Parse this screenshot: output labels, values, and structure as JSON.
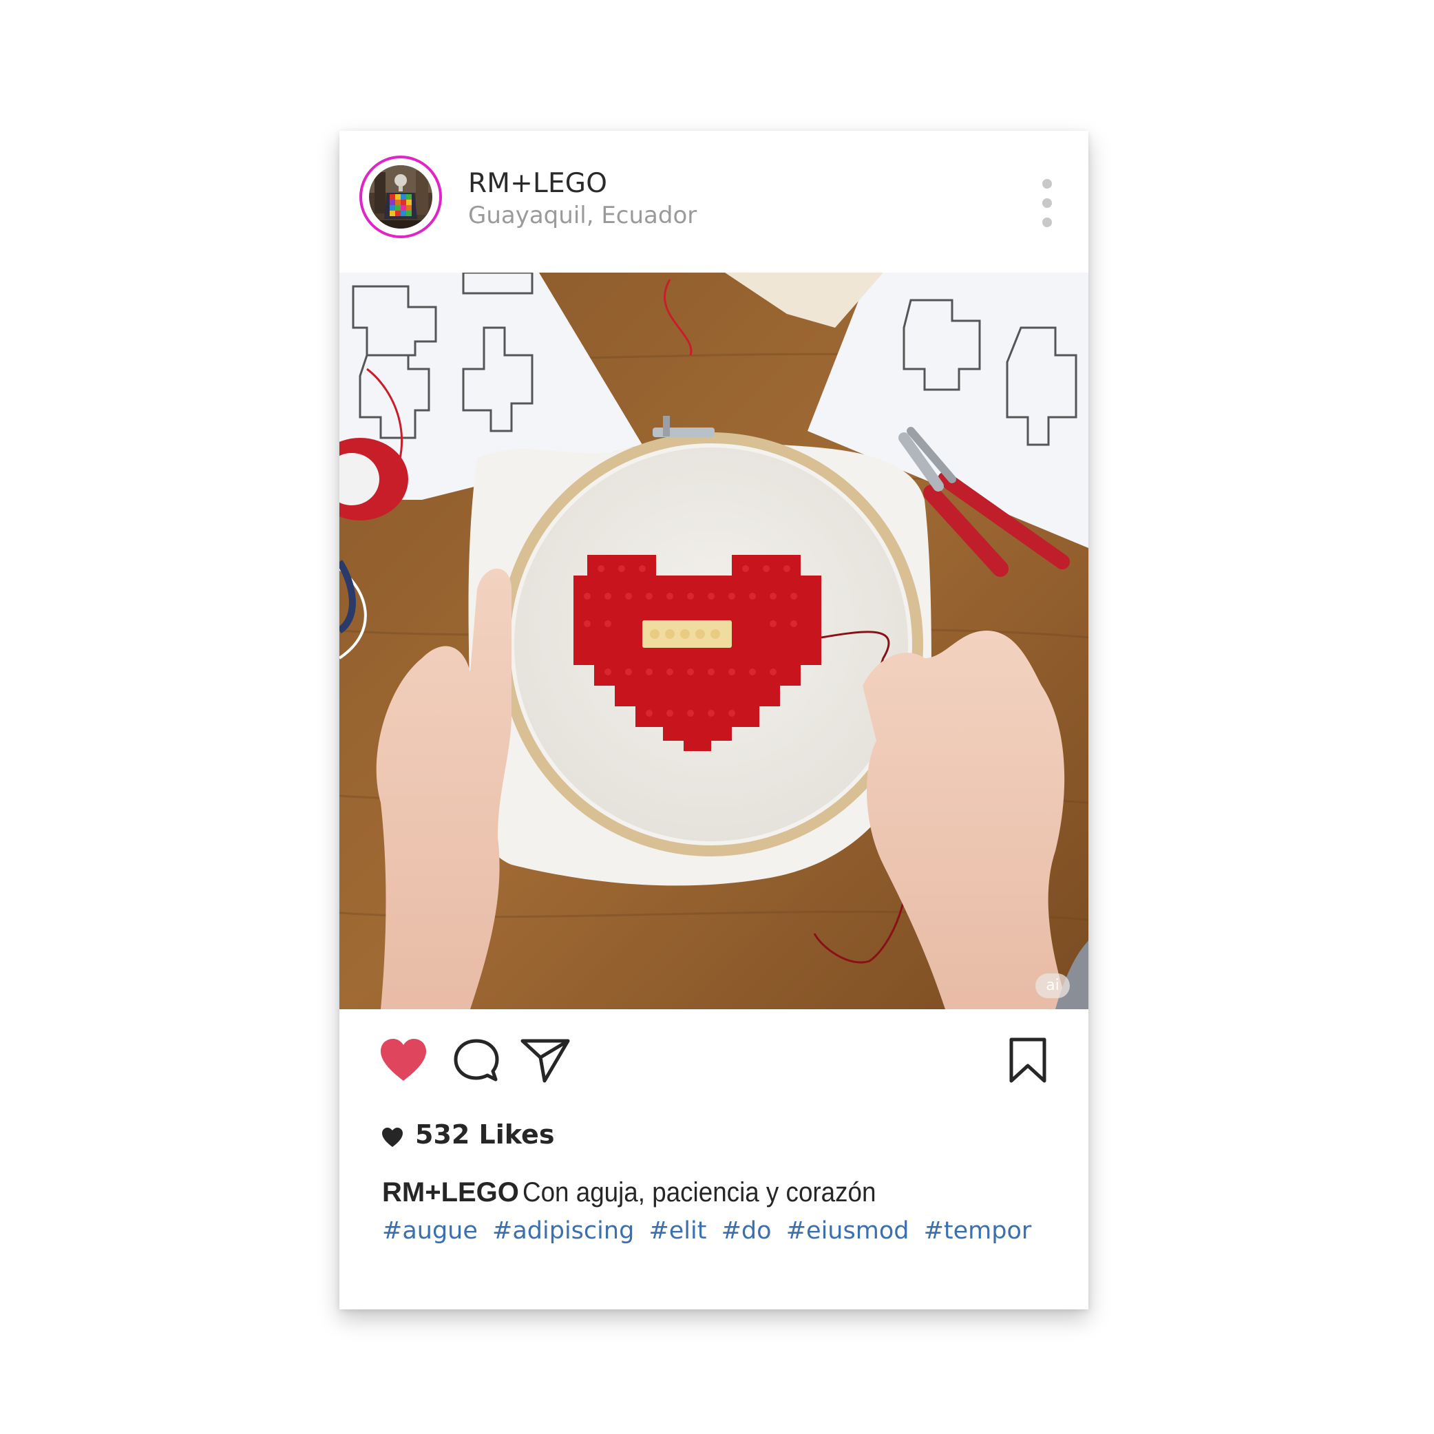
{
  "post": {
    "username": "RM+LEGO",
    "location": "Guayaquil, Ecuador",
    "more_icon": "more-vertical-icon",
    "image_badge": "ai",
    "likes_text": "532 Likes",
    "caption_user": "RM+LEGO",
    "caption_text": "Con aguja, paciencia y corazón",
    "hashtags": [
      "#augue",
      "#adipiscing",
      "#elit",
      "#do",
      "#eiusmod",
      "#tempor"
    ]
  },
  "actions": {
    "like_icon": "heart-filled-icon",
    "comment_icon": "comment-icon",
    "share_icon": "send-icon",
    "save_icon": "bookmark-icon"
  },
  "colors": {
    "avatar_ring": "#e024c8",
    "like": "#e0455e",
    "hashtag": "#3a6fb0",
    "text": "#262626",
    "muted": "#9a9a9a"
  }
}
